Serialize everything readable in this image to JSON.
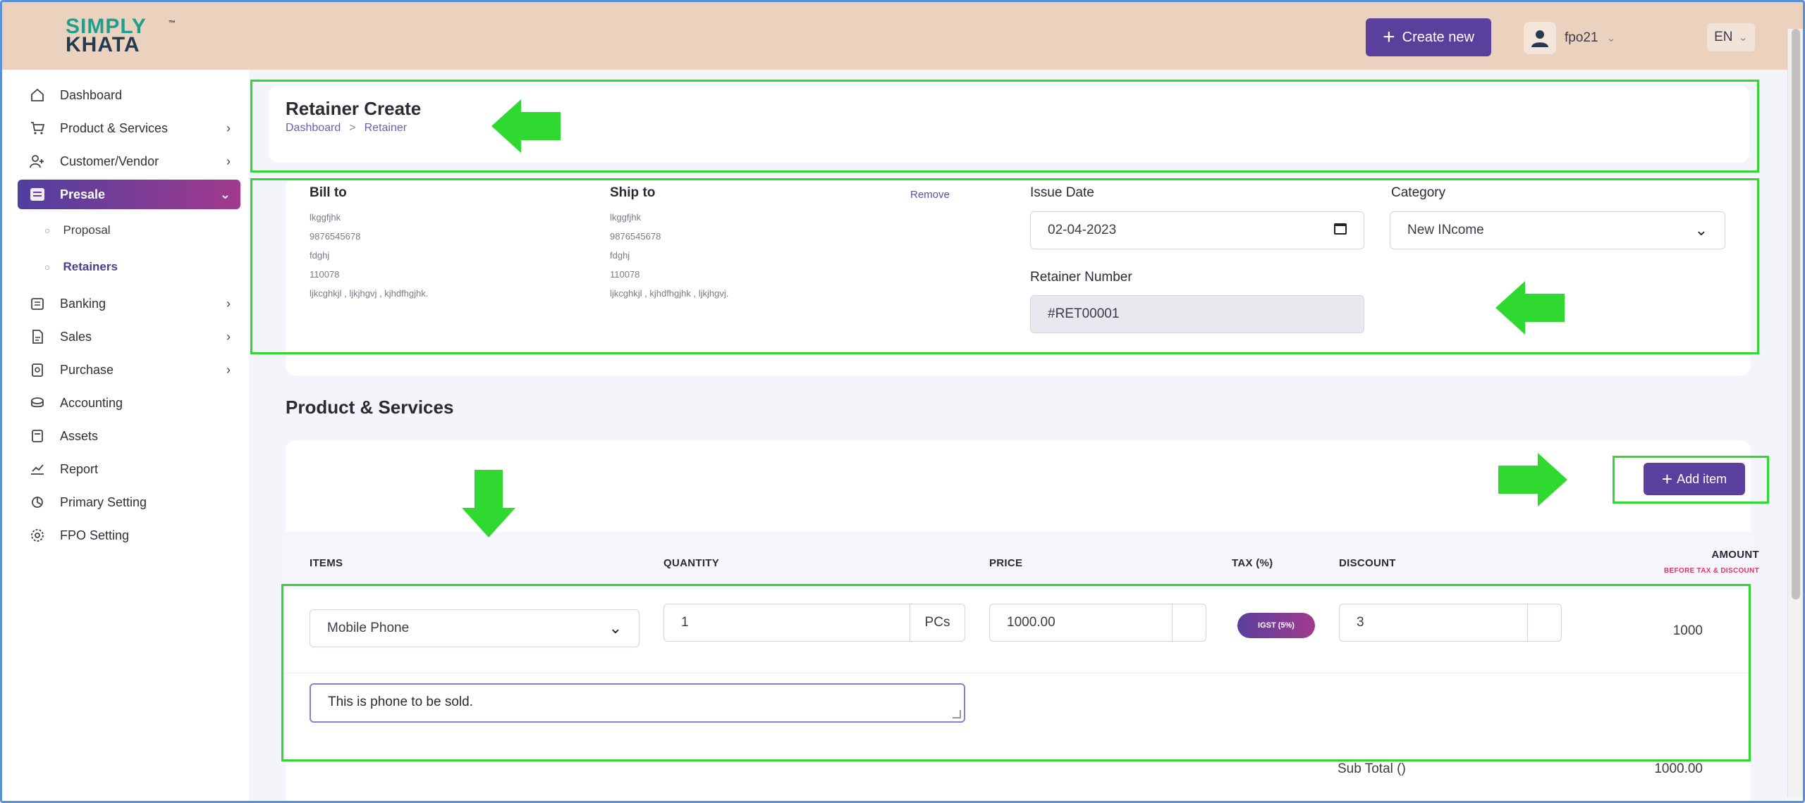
{
  "header": {
    "logo_top": "SIMPLY",
    "logo_bottom": "KHATA",
    "logo_tm": "™",
    "create_label": "Create new",
    "username": "fpo21",
    "language": "EN"
  },
  "sidebar": {
    "items": [
      {
        "label": "Dashboard",
        "icon": "home-icon",
        "arrow": ""
      },
      {
        "label": "Product & Services",
        "icon": "cart-icon",
        "arrow": "›"
      },
      {
        "label": "Customer/Vendor",
        "icon": "user-add-icon",
        "arrow": "›"
      },
      {
        "label": "Presale",
        "icon": "presale-icon",
        "arrow": "⌄"
      },
      {
        "label": "Banking",
        "icon": "bank-icon",
        "arrow": "›"
      },
      {
        "label": "Sales",
        "icon": "sales-icon",
        "arrow": "›"
      },
      {
        "label": "Purchase",
        "icon": "purchase-icon",
        "arrow": "›"
      },
      {
        "label": "Accounting",
        "icon": "accounting-icon",
        "arrow": ""
      },
      {
        "label": "Assets",
        "icon": "assets-icon",
        "arrow": ""
      },
      {
        "label": "Report",
        "icon": "report-icon",
        "arrow": ""
      },
      {
        "label": "Primary Setting",
        "icon": "settings-icon",
        "arrow": ""
      },
      {
        "label": "FPO Setting",
        "icon": "gear-icon",
        "arrow": ""
      }
    ],
    "presale_sub": [
      {
        "label": "Proposal"
      },
      {
        "label": "Retainers"
      }
    ]
  },
  "page": {
    "title": "Retainer Create",
    "breadcrumb": [
      "Dashboard",
      ">",
      "Retainer"
    ]
  },
  "bill_to": {
    "label": "Bill to",
    "lines": [
      "lkggfjhk",
      "9876545678",
      "fdghj",
      "110078",
      "ljkcghkjl , ljkjhgvj , kjhdfhgjhk."
    ]
  },
  "ship_to": {
    "label": "Ship to",
    "remove": "Remove",
    "lines": [
      "lkggfjhk",
      "9876545678",
      "fdghj",
      "110078",
      "ljkcghkjl , kjhdfhgjhk , ljkjhgvj."
    ]
  },
  "issue_date": {
    "label": "Issue Date",
    "value": "02-04-2023"
  },
  "category": {
    "label": "Category",
    "value": "New INcome"
  },
  "retainer_number": {
    "label": "Retainer Number",
    "value": "#RET00001"
  },
  "products": {
    "section_title": "Product & Services",
    "add_item": "Add item",
    "columns": {
      "items": "ITEMS",
      "quantity": "QUANTITY",
      "price": "PRICE",
      "tax": "TAX (%)",
      "discount": "DISCOUNT",
      "amount": "AMOUNT",
      "amount_note": "BEFORE TAX & DISCOUNT"
    },
    "row": {
      "item": "Mobile Phone",
      "quantity": "1",
      "unit": "PCs",
      "price": "1000.00",
      "tax_badge": "IGST (5%)",
      "discount": "3",
      "amount": "1000",
      "description": "This is phone to be sold."
    },
    "subtotal_label": "Sub Total ()",
    "subtotal_value": "1000.00"
  },
  "colors": {
    "accent": "#5a3f9c",
    "header_bg": "#ebd2bf",
    "highlight": "#2fd92f"
  }
}
